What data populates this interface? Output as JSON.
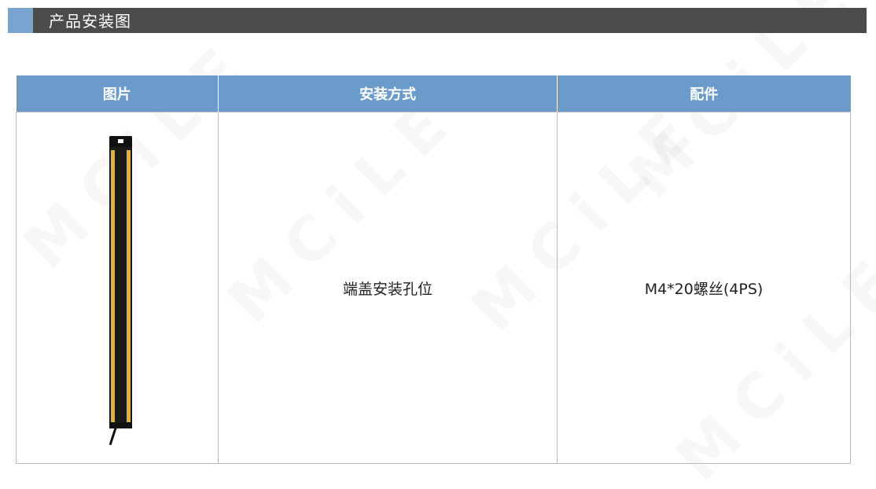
{
  "section": {
    "title": "产品安装图",
    "accent_color": "#7ba3cf",
    "bar_color": "#4b4b4b"
  },
  "watermark": {
    "text": "MCiLE"
  },
  "table": {
    "header_color": "#6b9bcb",
    "headers": [
      "图片",
      "安装方式",
      "配件"
    ],
    "row": {
      "image_icon": "light-curtain-bar",
      "install_method": "端盖安装孔位",
      "accessory": "M4*20螺丝(4PS)"
    }
  }
}
